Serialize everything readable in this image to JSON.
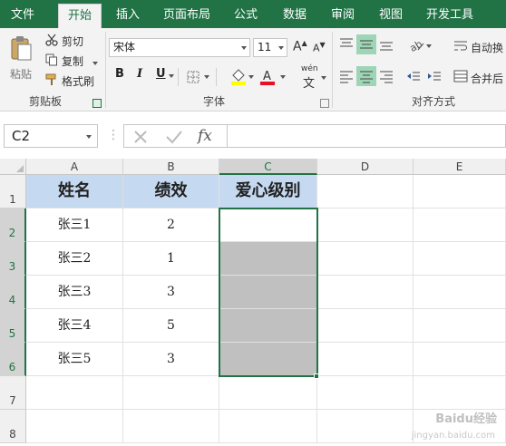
{
  "ribbon": {
    "tabs": [
      "文件",
      "开始",
      "插入",
      "页面布局",
      "公式",
      "数据",
      "审阅",
      "视图",
      "开发工具"
    ],
    "active_tab": "开始",
    "clipboard": {
      "paste": "粘贴",
      "cut": "剪切",
      "copy": "复制",
      "format_painter": "格式刷",
      "group_label": "剪贴板"
    },
    "font": {
      "name": "宋体",
      "size": "11",
      "bold": "B",
      "italic": "I",
      "underline": "U",
      "wen": "wén",
      "group_label": "字体"
    },
    "alignment": {
      "wrap_text": "自动换",
      "merge": "合并后",
      "group_label": "对齐方式"
    }
  },
  "formula_bar": {
    "name_box": "C2",
    "fx": "fx",
    "formula": ""
  },
  "sheet": {
    "columns": [
      "A",
      "B",
      "C",
      "D",
      "E"
    ],
    "rows": [
      "1",
      "2",
      "3",
      "4",
      "5",
      "6",
      "7",
      "8"
    ],
    "header": [
      "姓名",
      "绩效",
      "爱心级别"
    ],
    "data": [
      [
        "张三1",
        "2",
        ""
      ],
      [
        "张三2",
        "1",
        ""
      ],
      [
        "张三3",
        "3",
        ""
      ],
      [
        "张三4",
        "5",
        ""
      ],
      [
        "张三5",
        "3",
        ""
      ]
    ],
    "selected_range": "C2:C6"
  },
  "watermark": {
    "line1": "Baidu经验",
    "line2": "jingyan.baidu.com"
  },
  "colors": {
    "accent": "#217346",
    "header_fill": "#c5d9f1",
    "gray_fill": "#c0c0c0"
  }
}
